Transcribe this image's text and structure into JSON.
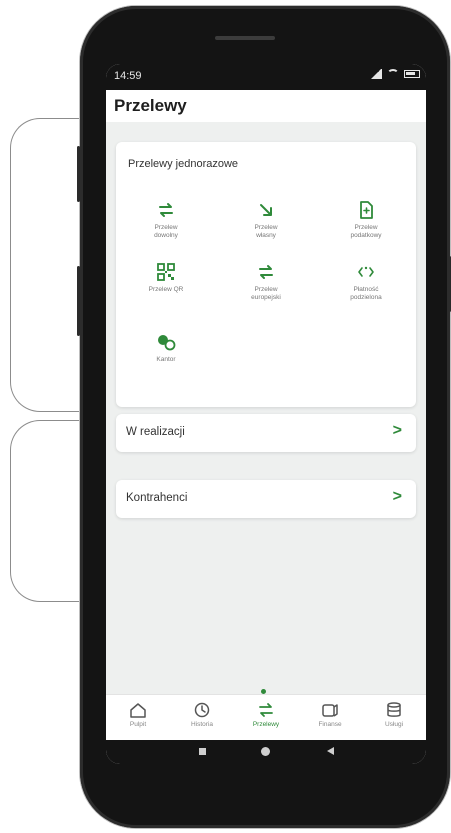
{
  "status": {
    "time": "14:59"
  },
  "header": {
    "title": "Przelewy"
  },
  "transfers_card": {
    "title": "Przelewy jednorazowe",
    "tiles": [
      {
        "label1": "Przelew",
        "label2": "dowolny",
        "icon": "swap-arrows-icon"
      },
      {
        "label1": "Przelew",
        "label2": "własny",
        "icon": "arrow-down-right-icon"
      },
      {
        "label1": "Przelew",
        "label2": "podatkowy",
        "icon": "tax-document-icon"
      },
      {
        "label1": "Przelew QR",
        "label2": "",
        "icon": "qr-code-icon"
      },
      {
        "label1": "Przelew",
        "label2": "europejski",
        "icon": "swap-arrows-icon"
      },
      {
        "label1": "Płatność",
        "label2": "podzielona",
        "icon": "split-payment-icon"
      },
      {
        "label1": "Kantor",
        "label2": "",
        "icon": "currency-exchange-icon"
      }
    ]
  },
  "rows": [
    {
      "label": "W realizacji",
      "chevron": ">"
    },
    {
      "label": "Kontrahenci",
      "chevron": ">"
    }
  ],
  "bottom_nav": [
    {
      "label": "Pulpit",
      "icon": "home-icon"
    },
    {
      "label": "Historia",
      "icon": "history-icon"
    },
    {
      "label": "Przelewy",
      "icon": "swap-arrows-icon",
      "active": true
    },
    {
      "label": "Finanse",
      "icon": "finance-icon"
    },
    {
      "label": "Usługi",
      "icon": "services-icon"
    }
  ],
  "colors": {
    "accent": "#2f8a3a",
    "background": "#eef0ef",
    "text": "#333333"
  }
}
